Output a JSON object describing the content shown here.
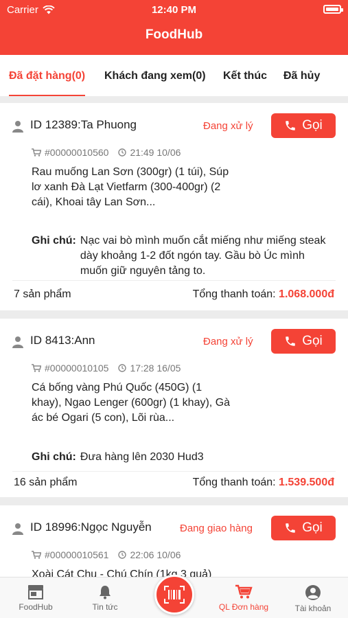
{
  "status_bar": {
    "carrier": "Carrier",
    "time": "12:40 PM"
  },
  "app": {
    "title": "FoodHub"
  },
  "tabs": [
    {
      "label": "Đã đặt hàng(0)",
      "active": true
    },
    {
      "label": "Khách đang xem(0)",
      "active": false
    },
    {
      "label": "Kết thúc",
      "active": false
    },
    {
      "label": "Đã hủy",
      "active": false
    }
  ],
  "colors": {
    "accent": "#f44336"
  },
  "orders": [
    {
      "id_label": "ID 12389:Ta Phuong",
      "status": "Đang xử lý",
      "call_label": "Gọi",
      "code": "#00000010560",
      "time": "21:49 10/06",
      "products": "Rau muống Lan Sơn (300gr) (1 túi), Súp lơ xanh Đà Lạt Vietfarm (300-400gr) (2 cái), Khoai tây Lan Sơn...",
      "note_label": "Ghi chú:",
      "note": "Nạc vai bò mình muốn cắt miếng như miếng steak dày khoảng 1-2 đốt ngón tay. Gầu bò Úc mình muốn giữ nguyên tảng to.",
      "item_count": "7 sản phẩm",
      "total_label": "Tổng thanh toán:",
      "total_value": "1.068.000đ"
    },
    {
      "id_label": "ID 8413:Ann",
      "status": "Đang xử lý",
      "call_label": "Gọi",
      "code": "#00000010105",
      "time": "17:28 16/05",
      "products": "Cá bống vàng Phú Quốc (450G) (1 khay), Ngao Lenger (600gr) (1 khay), Gà ác bé Ogari (5 con), Lõi rùa...",
      "note_label": "Ghi chú:",
      "note": "Đưa hàng lên 2030 Hud3",
      "item_count": "16 sản phẩm",
      "total_label": "Tổng thanh toán:",
      "total_value": "1.539.500đ"
    },
    {
      "id_label": "ID 18996:Ngọc Nguyễn",
      "status": "Đang giao hàng",
      "call_label": "Gọi",
      "code": "#00000010561",
      "time": "22:06 10/06",
      "products": "Xoài Cát Chu - Chú Chín (1kg 3 quả)"
    }
  ],
  "tabbar": [
    {
      "label": "FoodHub",
      "icon": "store-icon",
      "active": false
    },
    {
      "label": "Tin tức",
      "icon": "bell-icon",
      "active": false
    },
    {
      "label": "",
      "icon": "barcode-scan-icon",
      "active": false
    },
    {
      "label": "QL Đơn hàng",
      "icon": "cart-icon",
      "active": true
    },
    {
      "label": "Tài khoản",
      "icon": "account-icon",
      "active": false
    }
  ]
}
